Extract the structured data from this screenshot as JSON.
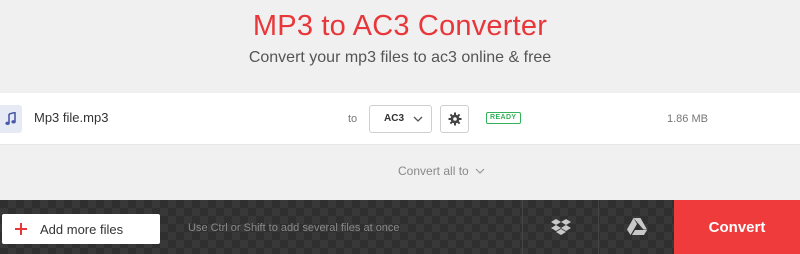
{
  "header": {
    "title": "MP3 to AC3 Converter",
    "subtitle": "Convert your mp3 files to ac3 online & free"
  },
  "file": {
    "icon": "music-note-icon",
    "name": "Mp3 file.mp3",
    "to_label": "to",
    "format_value": "AC3",
    "status": "READY",
    "size": "1.86 MB"
  },
  "convert_all": {
    "label": "Convert all to"
  },
  "bottom_bar": {
    "add_files_label": "Add more files",
    "hint": "Use Ctrl or Shift to add several files at once",
    "convert_label": "Convert",
    "dropbox_icon": "dropbox-icon",
    "gdrive_icon": "google-drive-icon"
  },
  "colors": {
    "accent": "#e8373a",
    "convert_button": "#ef3b3b",
    "ready": "#35b15a",
    "bottom_bar": "#2f2f2f"
  }
}
